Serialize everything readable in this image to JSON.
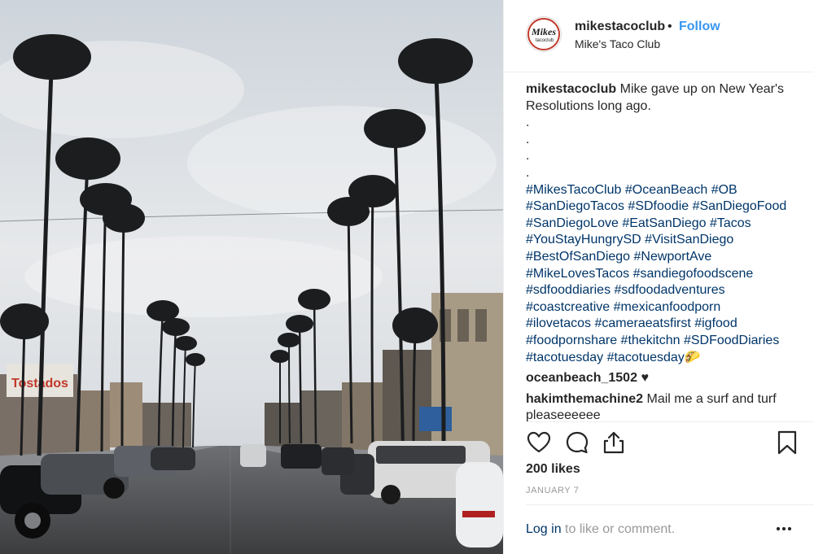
{
  "header": {
    "username": "mikestacoclub",
    "separator": "•",
    "follow_label": "Follow",
    "full_name": "Mike's Taco Club",
    "avatar_text": "Mikes",
    "avatar_subtext": "tacoclub"
  },
  "photo": {
    "signs": [
      "Tostados"
    ]
  },
  "caption": {
    "username": "mikestacoclub",
    "text": "Mike gave up on New Year's Resolutions long ago.",
    "dots": [
      ".",
      ".",
      ".",
      "."
    ],
    "hashtags": [
      "#MikesTacoClub",
      "#OceanBeach",
      "#OB",
      "#SanDiegoTacos",
      "#SDfoodie",
      "#SanDiegoFood",
      "#SanDiegoLove",
      "#EatSanDiego",
      "#Tacos",
      "#YouStayHungrySD",
      "#VisitSanDiego",
      "#BestOfSanDiego",
      "#NewportAve",
      "#MikeLovesTacos",
      "#sandiegofoodscene",
      "#sdfooddiaries",
      "#sdfoodadventures",
      "#coastcreative",
      "#mexicanfoodporn",
      "#ilovetacos",
      "#cameraeatsfirst",
      "#igfood",
      "#foodpornshare",
      "#thekitchn",
      "#SDFoodDiaries",
      "#tacotuesday",
      "#tacotuesday🌮"
    ]
  },
  "comments": [
    {
      "username": "oceanbeach_1502",
      "text": "♥"
    },
    {
      "username": "hakimthemachine2",
      "text": "Mail me a surf and turf pleaseeeeee"
    }
  ],
  "actions": {
    "like_icon": "heart-icon",
    "comment_icon": "comment-icon",
    "share_icon": "share-icon",
    "save_icon": "bookmark-icon"
  },
  "likes_label": "200 likes",
  "date_label": "JANUARY 7",
  "footer": {
    "login_label": "Log in",
    "rest_label": " to like or comment.",
    "more_icon": "more-options-icon"
  },
  "colors": {
    "link": "#003569",
    "follow": "#3897f0",
    "muted": "#999999"
  }
}
